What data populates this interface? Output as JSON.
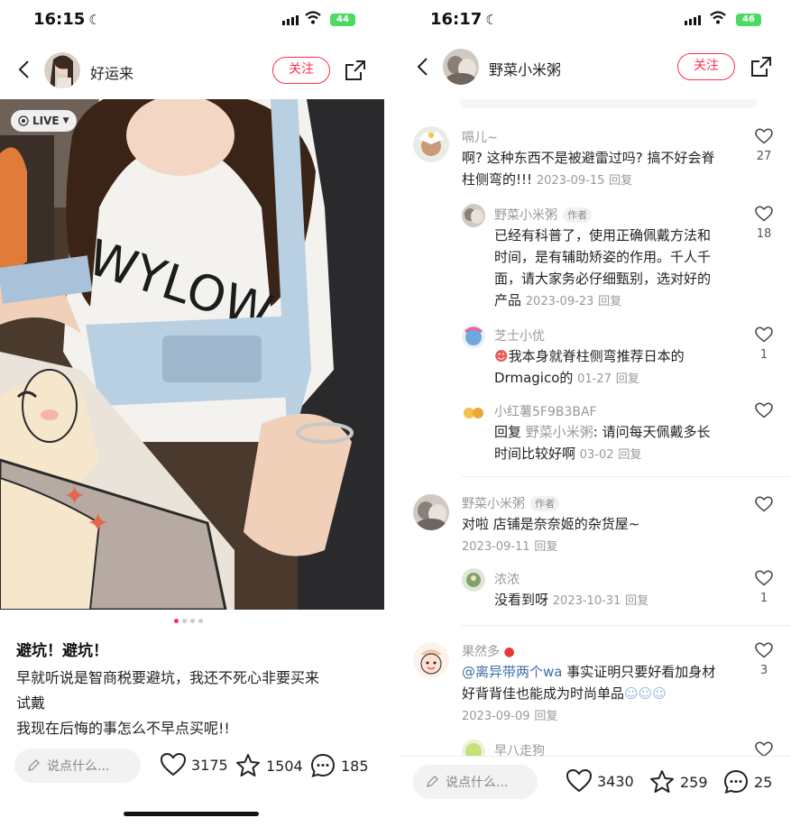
{
  "left": {
    "status": {
      "time": "16:15",
      "battery": "44"
    },
    "header": {
      "author": "好运来",
      "follow_label": "关注"
    },
    "photo": {
      "live_label": "LIVE",
      "shirt_text": "WYLOW"
    },
    "post": {
      "title": "避坑！避坑！",
      "body_lines": [
        "早就听说是智商税要避坑，我还不死心非要买来",
        "试戴",
        "我现在后悔的事怎么不早点买呢!!"
      ]
    },
    "bottom": {
      "comment_placeholder": "说点什么...",
      "likes": "3175",
      "favorites": "1504",
      "comments": "185"
    }
  },
  "right": {
    "status": {
      "time": "16:17",
      "battery": "46"
    },
    "header": {
      "author": "野菜小米粥",
      "follow_label": "关注"
    },
    "comments": [
      {
        "user": "嗝儿~",
        "lines": [
          "啊? 这种东西不是被避雷过吗? 搞不好会脊",
          "柱侧弯的!!! "
        ],
        "date": "2023-09-15",
        "reply": "回复",
        "likes": "27"
      },
      {
        "user": "野菜小米粥",
        "tag": "作者",
        "lines": [
          "已经有科普了，使用正确佩戴方法和",
          "时间，是有辅助矫姿的作用。千人千",
          "面，请大家务必仔细甄别，选对好的",
          "产品 "
        ],
        "date": "2023-09-23",
        "reply": "回复",
        "likes": "18"
      },
      {
        "user": "芝士小优",
        "lines": [
          "我本身就脊柱侧弯推荐日本的",
          "Drmagico的 "
        ],
        "date": "01-27",
        "reply": "回复",
        "likes": "1"
      },
      {
        "user": "小红薯5F9B3BAF",
        "reply_prefix": "回复 ",
        "reply_to": "野菜小米粥",
        "lines": [
          ": 请问每天佩戴多长",
          "时间比较好啊 "
        ],
        "date": "03-02",
        "reply": "回复",
        "likes": ""
      },
      {
        "user": "野菜小米粥",
        "tag": "作者",
        "lines": [
          "对啦 店铺是奈奈姬的杂货屋~"
        ],
        "date": "2023-09-11",
        "reply": "回复",
        "likes": ""
      },
      {
        "user": "浓浓",
        "lines": [
          "没看到呀 "
        ],
        "date": "2023-10-31",
        "reply": "回复",
        "likes": "1"
      },
      {
        "user": "果然多",
        "mention": "@离异带两个wa",
        "lines": [
          " 事实证明只要好看加身材",
          "好背背佳也能成为时尚单品"
        ],
        "date": "2023-09-09",
        "reply": "回复",
        "likes": "3"
      },
      {
        "user": "早八走狗"
      }
    ],
    "bottom": {
      "comment_placeholder": "说点什么...",
      "likes": "3430",
      "favorites": "259",
      "comments": "25"
    }
  },
  "colors": {
    "accent": "#ff2e4d",
    "muted": "#999999",
    "mention": "#3b6ea8"
  },
  "icons": [
    "back-arrow-icon",
    "share-icon",
    "heart-icon",
    "star-icon",
    "comment-bubble-icon",
    "pencil-icon",
    "wifi-icon",
    "moon-icon"
  ]
}
